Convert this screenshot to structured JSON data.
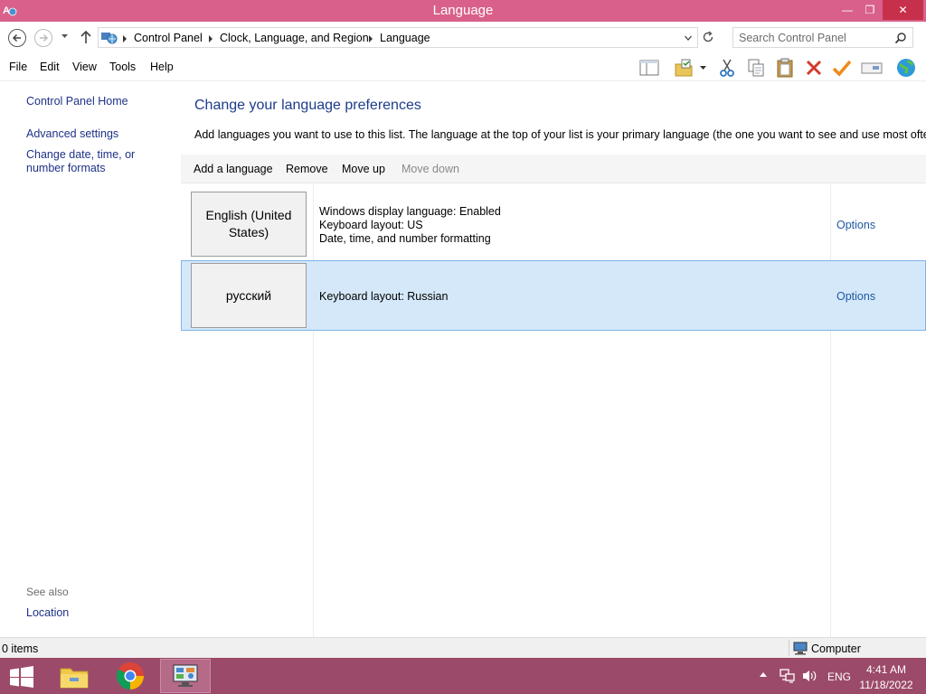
{
  "window": {
    "title": "Language",
    "minimize_glyph": "—",
    "maximize_glyph": "❐",
    "close_glyph": "✕"
  },
  "address": {
    "breadcrumbs": [
      "Control Panel",
      "Clock, Language, and Region",
      "Language"
    ],
    "search_placeholder": "Search Control Panel"
  },
  "menu": {
    "items": [
      "File",
      "Edit",
      "View",
      "Tools",
      "Help"
    ]
  },
  "toolbar": {
    "icons": [
      "layout-pane-icon",
      "properties-folder-icon",
      "dropdown-arrow-icon",
      "cut-icon",
      "copy-icon",
      "paste-icon",
      "delete-icon",
      "checkmark-icon",
      "rename-icon",
      "globe-icon"
    ]
  },
  "leftnav": {
    "home": "Control Panel Home",
    "advanced": "Advanced settings",
    "date_formats": "Change date, time, or number formats",
    "see_also": "See also",
    "location": "Location"
  },
  "main": {
    "title": "Change your language preferences",
    "description": "Add languages you want to use to this list. The language at the top of your list is your primary language (the one you want to see and use most often).",
    "commands": {
      "add": "Add a language",
      "remove": "Remove",
      "move_up": "Move up",
      "move_down": "Move down"
    },
    "languages": [
      {
        "name": "English (United States)",
        "details": [
          "Windows display language: Enabled",
          "Keyboard layout: US",
          "Date, time, and number formatting"
        ],
        "options": "Options",
        "selected": false
      },
      {
        "name": "русский",
        "details": [
          "Keyboard layout: Russian"
        ],
        "options": "Options",
        "selected": true
      }
    ]
  },
  "status": {
    "items": "0 items",
    "location": "Computer"
  },
  "taskbar": {
    "lang": "ENG",
    "time": "4:41 AM",
    "date": "11/18/2022"
  },
  "colors": {
    "titlebar": "#d9608a",
    "taskbar": "#9c4a6a",
    "link": "#1e3287",
    "selected_row": "#d5e8fa"
  }
}
